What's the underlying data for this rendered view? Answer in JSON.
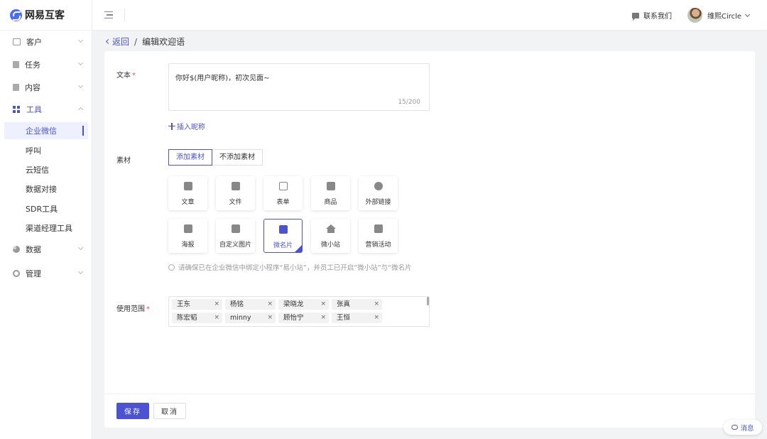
{
  "brand": {
    "name": "网易互客",
    "color": "#4b53d3"
  },
  "sidebar": {
    "items": [
      {
        "label": "客户",
        "icon": "id-card-icon"
      },
      {
        "label": "任务",
        "icon": "task-icon"
      },
      {
        "label": "内容",
        "icon": "document-icon"
      },
      {
        "label": "工具",
        "icon": "grid-icon"
      },
      {
        "label": "数据",
        "icon": "pie-chart-icon"
      },
      {
        "label": "管理",
        "icon": "gear-icon"
      }
    ],
    "tools_sub": [
      "企业微信",
      "呼叫",
      "云短信",
      "数据对接",
      "SDR工具",
      "渠道经理工具"
    ]
  },
  "header": {
    "contact_label": "联系我们",
    "user_name": "维熙Circle"
  },
  "breadcrumb": {
    "back": "返回",
    "separator": "/",
    "title": "编辑欢迎语"
  },
  "form": {
    "text_label": "文本",
    "required_mark": "*",
    "text_value": "你好$(用户昵称)，初次见面~",
    "counter": "15/200",
    "insert_nickname": "插入昵称",
    "material_label": "素材",
    "material_options": [
      "添加素材",
      "不添加素材"
    ],
    "tiles": [
      "文章",
      "文件",
      "表单",
      "商品",
      "外部链接",
      "海报",
      "自定义图片",
      "微名片",
      "微小站",
      "营销活动"
    ],
    "hint": "请确保已在企业微信中绑定小程序“易小站”，并员工已开启“微小站”与“微名片",
    "scope_label": "使用范围",
    "tags": [
      "王东",
      "杨铭",
      "梁晓龙",
      "张真",
      "陈宏韬",
      "minny",
      "顾怡宁",
      "王恒"
    ],
    "tag_remove": "×",
    "save": "保存",
    "cancel": "取消"
  },
  "message_widget": "消息"
}
